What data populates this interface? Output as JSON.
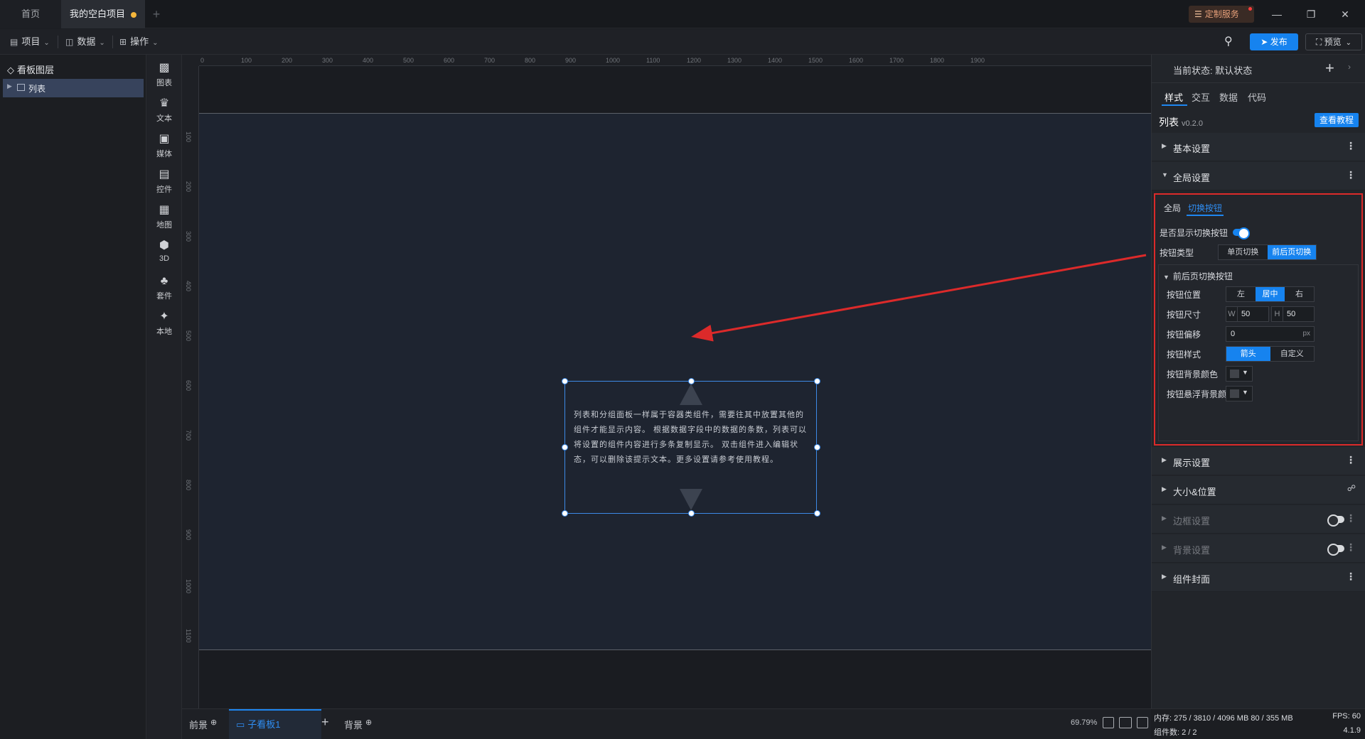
{
  "titlebar": {
    "tabs": [
      {
        "label": "首页"
      },
      {
        "label": "我的空白项目"
      }
    ],
    "add_tab": "+",
    "custom_service": "定制服务",
    "window": {
      "minimize": "—",
      "restore": "❐",
      "close": "✕"
    }
  },
  "toolbar": {
    "menus": [
      {
        "label": "项目"
      },
      {
        "label": "数据"
      },
      {
        "label": "操作"
      }
    ],
    "publish_label": "发布",
    "preview_label": "预览"
  },
  "layers": {
    "title": "看板图层",
    "items": [
      {
        "label": "列表"
      }
    ]
  },
  "comp_tools": [
    {
      "label": "图表",
      "icon": "chart-icon"
    },
    {
      "label": "文本",
      "icon": "text-icon"
    },
    {
      "label": "媒体",
      "icon": "media-icon"
    },
    {
      "label": "控件",
      "icon": "control-icon"
    },
    {
      "label": "地图",
      "icon": "map-icon"
    },
    {
      "label": "3D",
      "icon": "cube-icon"
    },
    {
      "label": "套件",
      "icon": "kit-icon"
    },
    {
      "label": "本地",
      "icon": "local-icon"
    }
  ],
  "ruler": {
    "h_labels": [
      "0",
      "100",
      "200",
      "300",
      "400",
      "500",
      "600",
      "700",
      "800",
      "900",
      "1000",
      "1100",
      "1200",
      "1300",
      "1400",
      "1500",
      "1600",
      "1700",
      "1800",
      "1900"
    ],
    "v_labels": [
      "100",
      "200",
      "300",
      "400",
      "500",
      "600",
      "700",
      "800",
      "900",
      "1000",
      "1100"
    ]
  },
  "canvas": {
    "widget_text": "列表和分组面板一样属于容器类组件，需要往其中放置其他的组件才能显示内容。 根据数据字段中的数据的条数，列表可以将设置的组件内容进行多条复制显示。 双击组件进入编辑状态，可以删除该提示文本。更多设置请参考使用教程。"
  },
  "bottombar": {
    "tabs": [
      {
        "label": "前景"
      },
      {
        "label": "子看板1"
      },
      {
        "label": "背景"
      }
    ],
    "add": "+",
    "zoom": "69.79%"
  },
  "right_panel": {
    "state_label": "当前状态:  默认状态",
    "tabs": [
      {
        "label": "样式"
      },
      {
        "label": "交互"
      },
      {
        "label": "数据"
      },
      {
        "label": "代码"
      }
    ],
    "component_name": "列表",
    "component_version": "v0.2.0",
    "tutorial_label": "查看教程",
    "sections": {
      "basic": "基本设置",
      "global": "全局设置",
      "display": "展示设置",
      "size_pos": "大小&位置",
      "border": "边框设置",
      "background": "背景设置",
      "cover": "组件封面"
    },
    "global_tabs": [
      {
        "label": "全局"
      },
      {
        "label": "切换按钮"
      }
    ],
    "show_toggle_label": "是否显示切换按钮",
    "show_toggle_on": true,
    "button_type": {
      "label": "按钮类型",
      "options": [
        "单页切换",
        "前后页切换"
      ],
      "selected": "前后页切换"
    },
    "prev_next": {
      "title": "前后页切换按钮",
      "position": {
        "label": "按钮位置",
        "options": [
          "左",
          "居中",
          "右"
        ],
        "selected": "居中"
      },
      "size": {
        "label": "按钮尺寸",
        "w_prefix": "W",
        "w": "50",
        "h_prefix": "H",
        "h": "50"
      },
      "offset": {
        "label": "按钮偏移",
        "value": "0",
        "unit": "px"
      },
      "style": {
        "label": "按钮样式",
        "options": [
          "箭头",
          "自定义"
        ],
        "selected": "箭头"
      },
      "bg_color_label": "按钮背景颜色",
      "hover_bg_color_label": "按钮悬浮背景颜色"
    }
  },
  "status": {
    "memory": "内存:  275 / 3810 / 4096 MB  80 / 355 MB",
    "fps": "FPS:  60",
    "components": "组件数: 2 / 2",
    "version": "4.1.9"
  },
  "colors": {
    "accent": "#1683ef",
    "annotation": "#dc2a2a"
  }
}
